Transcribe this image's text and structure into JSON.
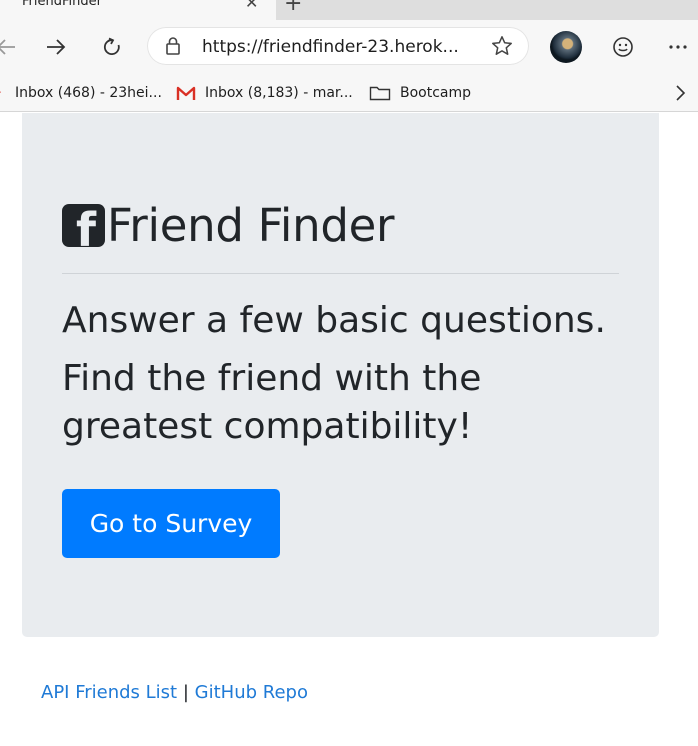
{
  "browser": {
    "tab_title": "FriendFinder",
    "url": "https://friendfinder-23.herok...",
    "bookmarks": [
      {
        "label": "Inbox (468) - 23hei...",
        "icon": "gmail-icon"
      },
      {
        "label": "Inbox (8,183) - mar...",
        "icon": "gmail-icon"
      },
      {
        "label": "Bootcamp",
        "icon": "folder-icon"
      }
    ]
  },
  "hero": {
    "title": "Friend Finder",
    "line1": "Answer a few basic questions.",
    "line2": "Find the friend with the greatest compatibility!",
    "cta_label": "Go to Survey"
  },
  "footer": {
    "link1": "API Friends List",
    "separator": "|",
    "link2": "GitHub Repo"
  },
  "colors": {
    "accent": "#007bff",
    "jumbotron_bg": "#e9ecef",
    "link": "#1f7ad6",
    "gmail_red": "#d93025"
  }
}
